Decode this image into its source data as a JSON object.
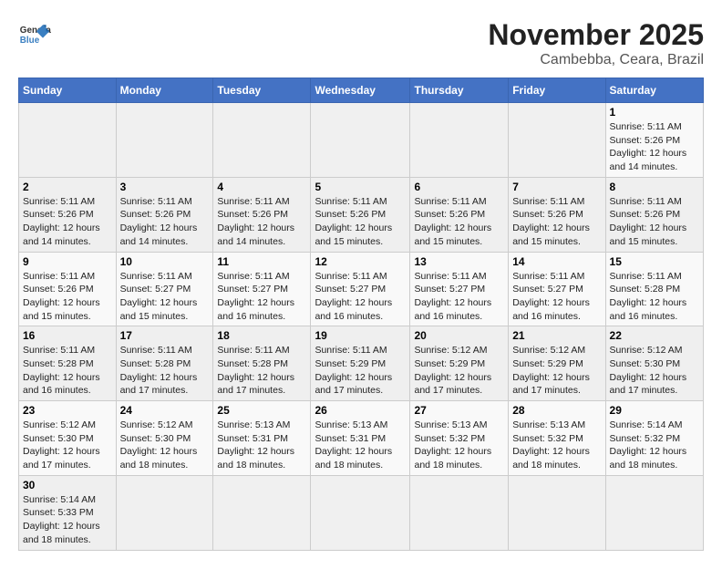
{
  "header": {
    "logo_general": "General",
    "logo_blue": "Blue",
    "month_title": "November 2025",
    "location": "Cambebba, Ceara, Brazil"
  },
  "weekdays": [
    "Sunday",
    "Monday",
    "Tuesday",
    "Wednesday",
    "Thursday",
    "Friday",
    "Saturday"
  ],
  "weeks": [
    [
      {
        "day": "",
        "info": ""
      },
      {
        "day": "",
        "info": ""
      },
      {
        "day": "",
        "info": ""
      },
      {
        "day": "",
        "info": ""
      },
      {
        "day": "",
        "info": ""
      },
      {
        "day": "",
        "info": ""
      },
      {
        "day": "1",
        "info": "Sunrise: 5:11 AM\nSunset: 5:26 PM\nDaylight: 12 hours\nand 14 minutes."
      }
    ],
    [
      {
        "day": "2",
        "info": "Sunrise: 5:11 AM\nSunset: 5:26 PM\nDaylight: 12 hours\nand 14 minutes."
      },
      {
        "day": "3",
        "info": "Sunrise: 5:11 AM\nSunset: 5:26 PM\nDaylight: 12 hours\nand 14 minutes."
      },
      {
        "day": "4",
        "info": "Sunrise: 5:11 AM\nSunset: 5:26 PM\nDaylight: 12 hours\nand 14 minutes."
      },
      {
        "day": "5",
        "info": "Sunrise: 5:11 AM\nSunset: 5:26 PM\nDaylight: 12 hours\nand 15 minutes."
      },
      {
        "day": "6",
        "info": "Sunrise: 5:11 AM\nSunset: 5:26 PM\nDaylight: 12 hours\nand 15 minutes."
      },
      {
        "day": "7",
        "info": "Sunrise: 5:11 AM\nSunset: 5:26 PM\nDaylight: 12 hours\nand 15 minutes."
      },
      {
        "day": "8",
        "info": "Sunrise: 5:11 AM\nSunset: 5:26 PM\nDaylight: 12 hours\nand 15 minutes."
      }
    ],
    [
      {
        "day": "9",
        "info": "Sunrise: 5:11 AM\nSunset: 5:26 PM\nDaylight: 12 hours\nand 15 minutes."
      },
      {
        "day": "10",
        "info": "Sunrise: 5:11 AM\nSunset: 5:27 PM\nDaylight: 12 hours\nand 15 minutes."
      },
      {
        "day": "11",
        "info": "Sunrise: 5:11 AM\nSunset: 5:27 PM\nDaylight: 12 hours\nand 16 minutes."
      },
      {
        "day": "12",
        "info": "Sunrise: 5:11 AM\nSunset: 5:27 PM\nDaylight: 12 hours\nand 16 minutes."
      },
      {
        "day": "13",
        "info": "Sunrise: 5:11 AM\nSunset: 5:27 PM\nDaylight: 12 hours\nand 16 minutes."
      },
      {
        "day": "14",
        "info": "Sunrise: 5:11 AM\nSunset: 5:27 PM\nDaylight: 12 hours\nand 16 minutes."
      },
      {
        "day": "15",
        "info": "Sunrise: 5:11 AM\nSunset: 5:28 PM\nDaylight: 12 hours\nand 16 minutes."
      }
    ],
    [
      {
        "day": "16",
        "info": "Sunrise: 5:11 AM\nSunset: 5:28 PM\nDaylight: 12 hours\nand 16 minutes."
      },
      {
        "day": "17",
        "info": "Sunrise: 5:11 AM\nSunset: 5:28 PM\nDaylight: 12 hours\nand 17 minutes."
      },
      {
        "day": "18",
        "info": "Sunrise: 5:11 AM\nSunset: 5:28 PM\nDaylight: 12 hours\nand 17 minutes."
      },
      {
        "day": "19",
        "info": "Sunrise: 5:11 AM\nSunset: 5:29 PM\nDaylight: 12 hours\nand 17 minutes."
      },
      {
        "day": "20",
        "info": "Sunrise: 5:12 AM\nSunset: 5:29 PM\nDaylight: 12 hours\nand 17 minutes."
      },
      {
        "day": "21",
        "info": "Sunrise: 5:12 AM\nSunset: 5:29 PM\nDaylight: 12 hours\nand 17 minutes."
      },
      {
        "day": "22",
        "info": "Sunrise: 5:12 AM\nSunset: 5:30 PM\nDaylight: 12 hours\nand 17 minutes."
      }
    ],
    [
      {
        "day": "23",
        "info": "Sunrise: 5:12 AM\nSunset: 5:30 PM\nDaylight: 12 hours\nand 17 minutes."
      },
      {
        "day": "24",
        "info": "Sunrise: 5:12 AM\nSunset: 5:30 PM\nDaylight: 12 hours\nand 18 minutes."
      },
      {
        "day": "25",
        "info": "Sunrise: 5:13 AM\nSunset: 5:31 PM\nDaylight: 12 hours\nand 18 minutes."
      },
      {
        "day": "26",
        "info": "Sunrise: 5:13 AM\nSunset: 5:31 PM\nDaylight: 12 hours\nand 18 minutes."
      },
      {
        "day": "27",
        "info": "Sunrise: 5:13 AM\nSunset: 5:32 PM\nDaylight: 12 hours\nand 18 minutes."
      },
      {
        "day": "28",
        "info": "Sunrise: 5:13 AM\nSunset: 5:32 PM\nDaylight: 12 hours\nand 18 minutes."
      },
      {
        "day": "29",
        "info": "Sunrise: 5:14 AM\nSunset: 5:32 PM\nDaylight: 12 hours\nand 18 minutes."
      }
    ],
    [
      {
        "day": "30",
        "info": "Sunrise: 5:14 AM\nSunset: 5:33 PM\nDaylight: 12 hours\nand 18 minutes."
      },
      {
        "day": "",
        "info": ""
      },
      {
        "day": "",
        "info": ""
      },
      {
        "day": "",
        "info": ""
      },
      {
        "day": "",
        "info": ""
      },
      {
        "day": "",
        "info": ""
      },
      {
        "day": "",
        "info": ""
      }
    ]
  ]
}
